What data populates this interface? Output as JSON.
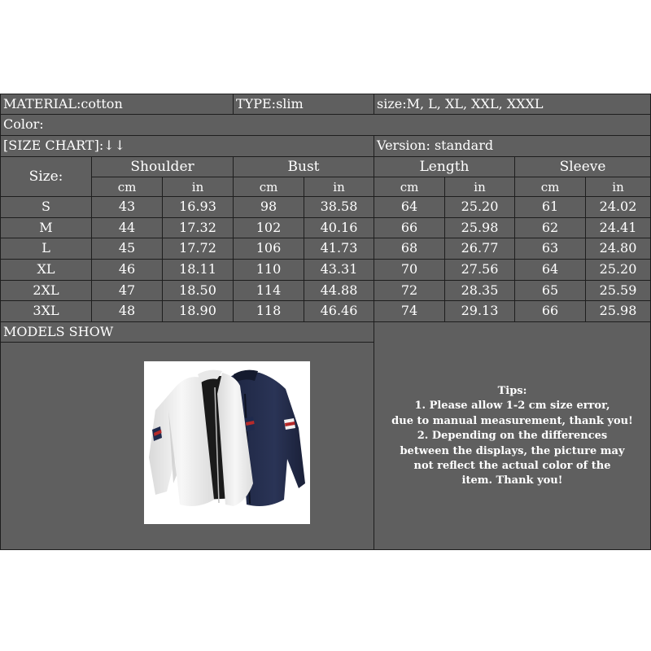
{
  "header": {
    "material": "MATERIAL:cotton",
    "type": "TYPE:slim",
    "size": "size:M, L, XL, XXL, XXXL",
    "color": "Color:",
    "size_chart": "[SIZE CHART]:↓↓",
    "version": "Version: standard"
  },
  "table": {
    "size_label": "Size:",
    "groups": [
      "Shoulder",
      "Bust",
      "Length",
      "Sleeve"
    ],
    "units": [
      "cm",
      "in",
      "cm",
      "in",
      "cm",
      "in",
      "cm",
      "in"
    ],
    "rows": [
      {
        "size": "S",
        "values": [
          "43",
          "16.93",
          "98",
          "38.58",
          "64",
          "25.20",
          "61",
          "24.02"
        ]
      },
      {
        "size": "M",
        "values": [
          "44",
          "17.32",
          "102",
          "40.16",
          "66",
          "25.98",
          "62",
          "24.41"
        ]
      },
      {
        "size": "L",
        "values": [
          "45",
          "17.72",
          "106",
          "41.73",
          "68",
          "26.77",
          "63",
          "24.80"
        ]
      },
      {
        "size": "XL",
        "values": [
          "46",
          "18.11",
          "110",
          "43.31",
          "70",
          "27.56",
          "64",
          "25.20"
        ]
      },
      {
        "size": "2XL",
        "values": [
          "47",
          "18.50",
          "114",
          "44.88",
          "72",
          "28.35",
          "65",
          "25.59"
        ]
      },
      {
        "size": "3XL",
        "values": [
          "48",
          "18.90",
          "118",
          "46.46",
          "74",
          "29.13",
          "66",
          "25.98"
        ]
      }
    ]
  },
  "models_show": "MODELS SHOW",
  "tips": {
    "lines": [
      "Tips:",
      "1. Please allow 1-2 cm size error,",
      "due to manual measurement, thank you!",
      "2. Depending on the differences",
      "between the displays, the picture may",
      "not reflect the actual color of the",
      "item. Thank you!"
    ]
  }
}
